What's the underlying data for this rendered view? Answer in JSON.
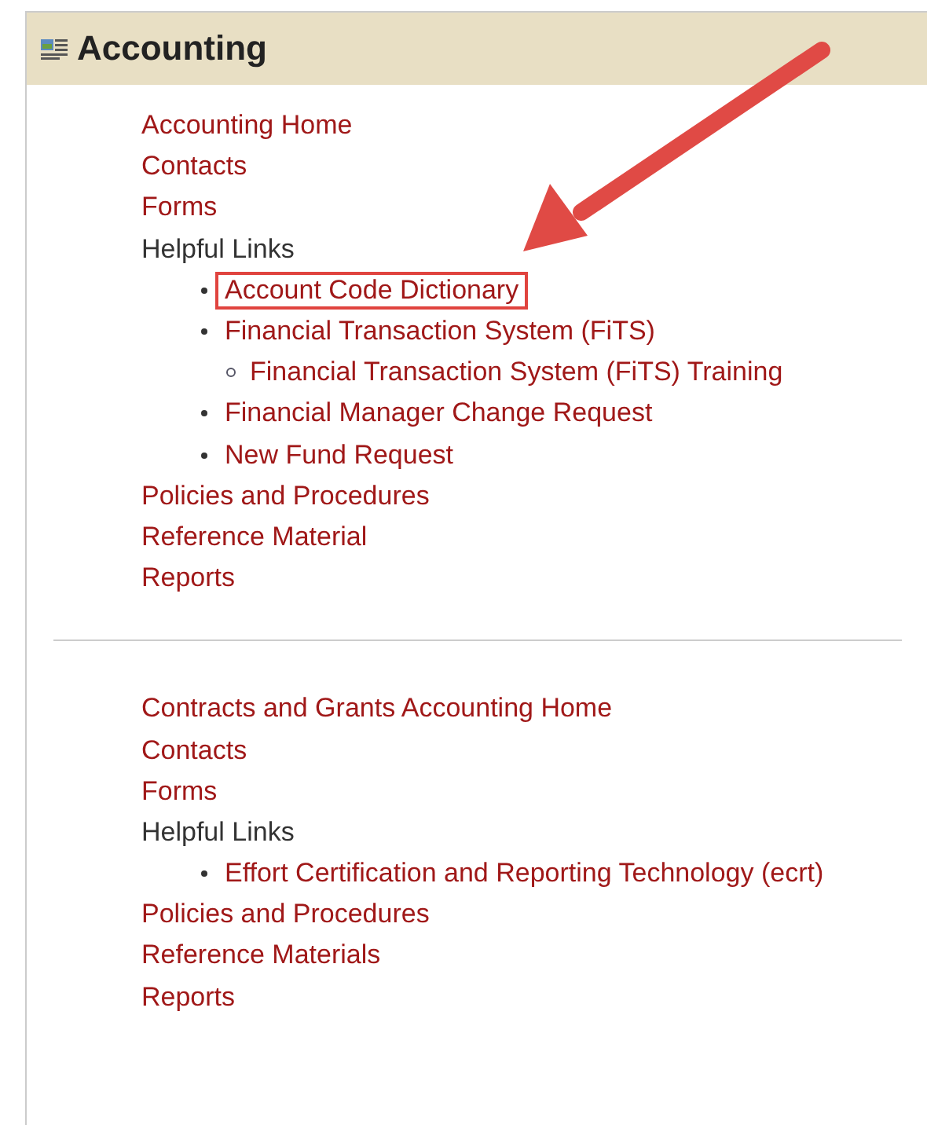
{
  "panel": {
    "title": "Accounting"
  },
  "sections": [
    {
      "items": [
        {
          "kind": "link",
          "label": "Accounting Home"
        },
        {
          "kind": "link",
          "label": "Contacts"
        },
        {
          "kind": "link",
          "label": "Forms"
        },
        {
          "kind": "heading",
          "label": "Helpful Links",
          "children": [
            {
              "kind": "link",
              "label": "Account Code Dictionary",
              "highlighted": true
            },
            {
              "kind": "link",
              "label": "Financial Transaction System (FiTS)",
              "highlighted": false,
              "children": [
                {
                  "kind": "link",
                  "label": "Financial Transaction System (FiTS) Training",
                  "highlighted": false
                }
              ]
            },
            {
              "kind": "link",
              "label": "Financial Manager Change Request",
              "highlighted": false
            },
            {
              "kind": "link",
              "label": "New Fund Request",
              "highlighted": false
            }
          ]
        },
        {
          "kind": "link",
          "label": "Policies and Procedures"
        },
        {
          "kind": "link",
          "label": "Reference Material"
        },
        {
          "kind": "link",
          "label": "Reports"
        }
      ]
    },
    {
      "items": [
        {
          "kind": "link",
          "label": "Contracts and Grants Accounting Home"
        },
        {
          "kind": "link",
          "label": "Contacts"
        },
        {
          "kind": "link",
          "label": "Forms"
        },
        {
          "kind": "heading",
          "label": "Helpful Links",
          "children": [
            {
              "kind": "link",
              "label": "Effort Certification and Reporting Technology (ecrt)",
              "highlighted": false
            }
          ]
        },
        {
          "kind": "link",
          "label": "Policies and Procedures"
        },
        {
          "kind": "link",
          "label": "Reference Materials"
        },
        {
          "kind": "link",
          "label": "Reports"
        }
      ]
    }
  ]
}
